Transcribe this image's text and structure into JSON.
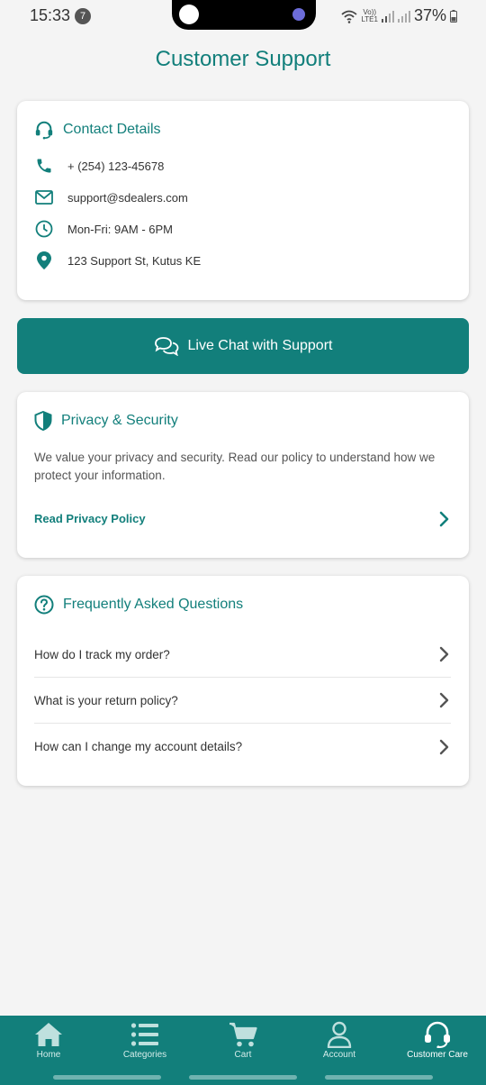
{
  "status_bar": {
    "time": "15:33",
    "notification_count": "7",
    "network_label_top": "Vo))",
    "network_label_bottom": "LTE1",
    "battery": "37%"
  },
  "header": {
    "title": "Customer Support"
  },
  "contact": {
    "title": "Contact Details",
    "phone": "+ (254) 123-45678",
    "email": "support@sdealers.com",
    "hours": "Mon-Fri: 9AM - 6PM",
    "address": "123 Support St, Kutus KE"
  },
  "live_chat": {
    "label": "Live Chat with Support"
  },
  "privacy": {
    "title": "Privacy & Security",
    "text": "We value your privacy and security. Read our policy to understand how we protect your information.",
    "link_label": "Read Privacy Policy"
  },
  "faq": {
    "title": "Frequently Asked Questions",
    "items": [
      {
        "question": "How do I track my order?"
      },
      {
        "question": "What is your return policy?"
      },
      {
        "question": "How can I change my account details?"
      }
    ]
  },
  "bottom_nav": {
    "items": [
      {
        "label": "Home",
        "icon": "home-icon"
      },
      {
        "label": "Categories",
        "icon": "list-icon"
      },
      {
        "label": "Cart",
        "icon": "cart-icon"
      },
      {
        "label": "Account",
        "icon": "user-icon"
      },
      {
        "label": "Customer Care",
        "icon": "headset-icon",
        "active": true
      }
    ]
  },
  "colors": {
    "brand": "#127f7b",
    "background": "#f4f4f4",
    "card": "#ffffff"
  }
}
